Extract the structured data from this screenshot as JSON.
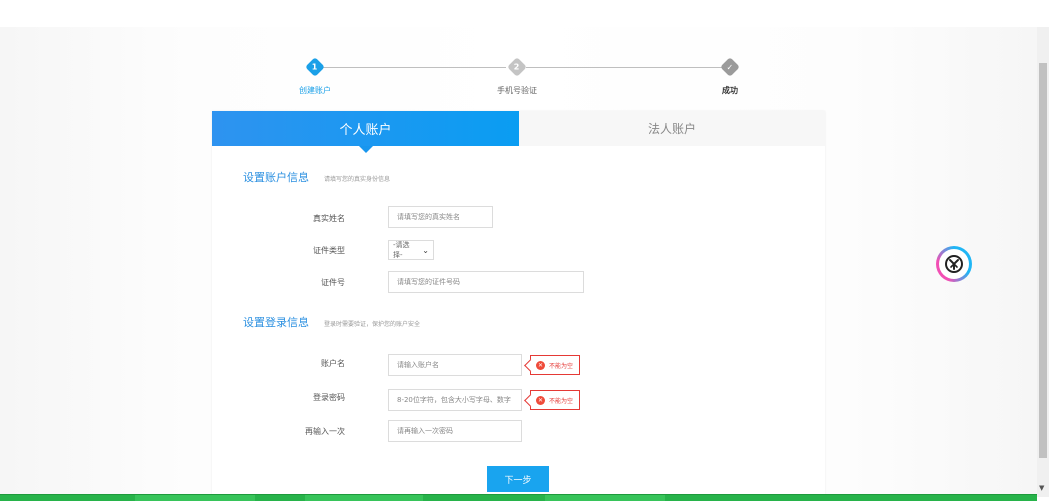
{
  "steps": [
    {
      "number": "1",
      "label": "创建账户",
      "state": "active"
    },
    {
      "number": "2",
      "label": "手机号验证",
      "state": "inactive"
    },
    {
      "number": "✓",
      "label": "成功",
      "state": "done"
    }
  ],
  "tabs": {
    "personal": "个人账户",
    "legal": "法人账户"
  },
  "section_account": {
    "title": "设置账户信息",
    "hint": "请填写您的真实身份信息"
  },
  "fields_account": {
    "real_name_label": "真实姓名",
    "real_name_placeholder": "请填写您的真实姓名",
    "id_type_label": "证件类型",
    "id_type_value": "-请选择-",
    "id_number_label": "证件号",
    "id_number_placeholder": "请填写您的证件号码"
  },
  "section_login": {
    "title": "设置登录信息",
    "hint": "登录时需要验证，保护您的账户安全"
  },
  "fields_login": {
    "username_label": "账户名",
    "username_placeholder": "请输入账户名",
    "username_error": "不能为空",
    "password_label": "登录密码",
    "password_placeholder": "8-20位字符，包含大小写字母、数字",
    "password_error": "不能为空",
    "confirm_label": "再输入一次",
    "confirm_placeholder": "请再输入一次密码"
  },
  "next_button": "下一步",
  "colors": {
    "accent": "#1aa0e8",
    "error": "#e53935",
    "tab_active": "#1896ee",
    "bottom_bar": "#27b34a"
  },
  "icons": {
    "error": "error-x-icon",
    "select_arrow": "chevron-down-icon",
    "logo": "app-logo-icon"
  }
}
